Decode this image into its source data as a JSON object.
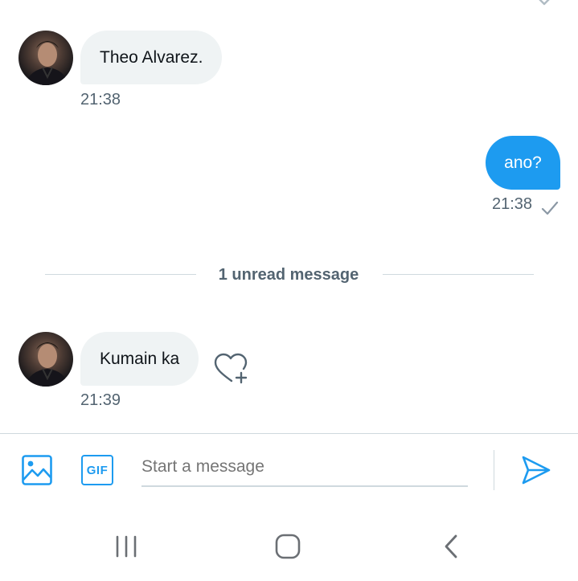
{
  "messages": [
    {
      "direction": "incoming",
      "text": "Theo Alvarez.",
      "time": "21:38"
    },
    {
      "direction": "outgoing",
      "text": "ano?",
      "time": "21:38",
      "status_icon": "checkmark-icon"
    },
    {
      "direction": "incoming",
      "text": "Kumain ka",
      "time": "21:39",
      "reaction_icon": "heart-plus-icon"
    }
  ],
  "unread_divider": {
    "label": "1 unread message"
  },
  "composer": {
    "placeholder": "Start a message",
    "media_icon": "image-icon",
    "gif_icon": "gif-icon",
    "gif_label": "GIF",
    "send_icon": "send-icon"
  },
  "navbar": {
    "icons": [
      "recent-apps-icon",
      "home-icon",
      "back-icon"
    ]
  },
  "colors": {
    "accent": "#1d9bf0",
    "bubble_incoming": "#eff3f4",
    "secondary_text": "#536471",
    "divider": "#cfd9de"
  }
}
